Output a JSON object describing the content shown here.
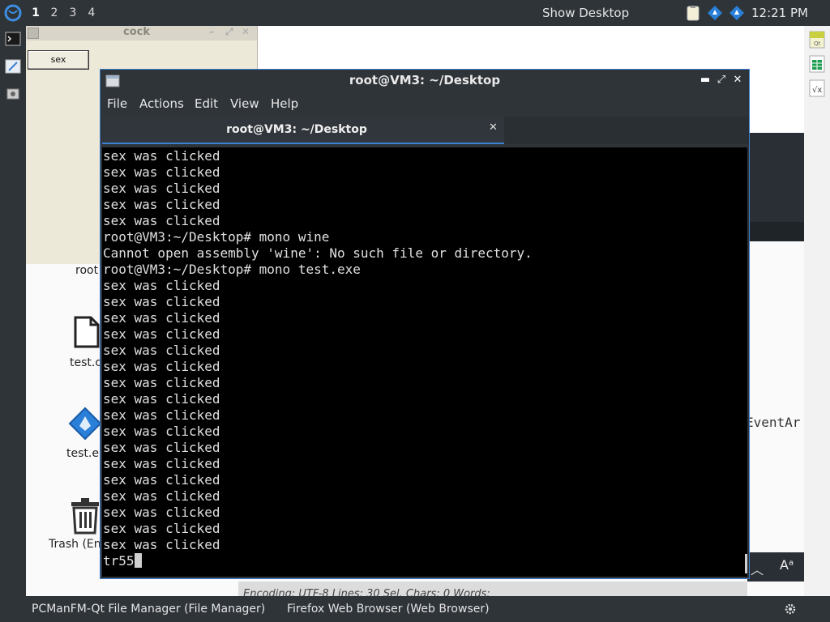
{
  "top_panel": {
    "workspaces": [
      "1",
      "2",
      "3",
      "4"
    ],
    "active_workspace": "1",
    "show_desktop": "Show Desktop",
    "clock": "12:21 PM"
  },
  "background_window": {
    "title": "cock",
    "button_label": "sex"
  },
  "desktop_icons": [
    {
      "label": "root",
      "icon": "folder-icon"
    },
    {
      "label": "test.c",
      "icon": "file-icon"
    },
    {
      "label": "test.e",
      "icon": "mono-exe-icon"
    },
    {
      "label": "Trash (En",
      "icon": "trash-icon"
    }
  ],
  "editor_fragment": {
    "visible_text": "EventAr",
    "status_text": "Encoding: UTF-8 Lines: 30 Sel. Chars: 0 Words:"
  },
  "terminal": {
    "title": "root@VM3: ~/Desktop",
    "menu": [
      "File",
      "Actions",
      "Edit",
      "View",
      "Help"
    ],
    "tab_label": "root@VM3: ~/Desktop",
    "lines": [
      "sex was clicked",
      "sex was clicked",
      "sex was clicked",
      "sex was clicked",
      "sex was clicked",
      "root@VM3:~/Desktop# mono wine",
      "Cannot open assembly 'wine': No such file or directory.",
      "root@VM3:~/Desktop# mono test.exe",
      "sex was clicked",
      "sex was clicked",
      "sex was clicked",
      "sex was clicked",
      "sex was clicked",
      "sex was clicked",
      "sex was clicked",
      "sex was clicked",
      "sex was clicked",
      "sex was clicked",
      "sex was clicked",
      "sex was clicked",
      "sex was clicked",
      "sex was clicked",
      "sex was clicked",
      "sex was clicked",
      "sex was clicked"
    ],
    "current_input": "tr55"
  },
  "taskbar": {
    "items": [
      "PCManFM-Qt File Manager (File Manager)",
      "Firefox Web Browser (Web Browser)"
    ]
  },
  "colors": {
    "panel_bg": "#2f3439",
    "accent": "#3d7fd1",
    "terminal_bg": "#000000",
    "terminal_fg": "#e0e0e0"
  }
}
